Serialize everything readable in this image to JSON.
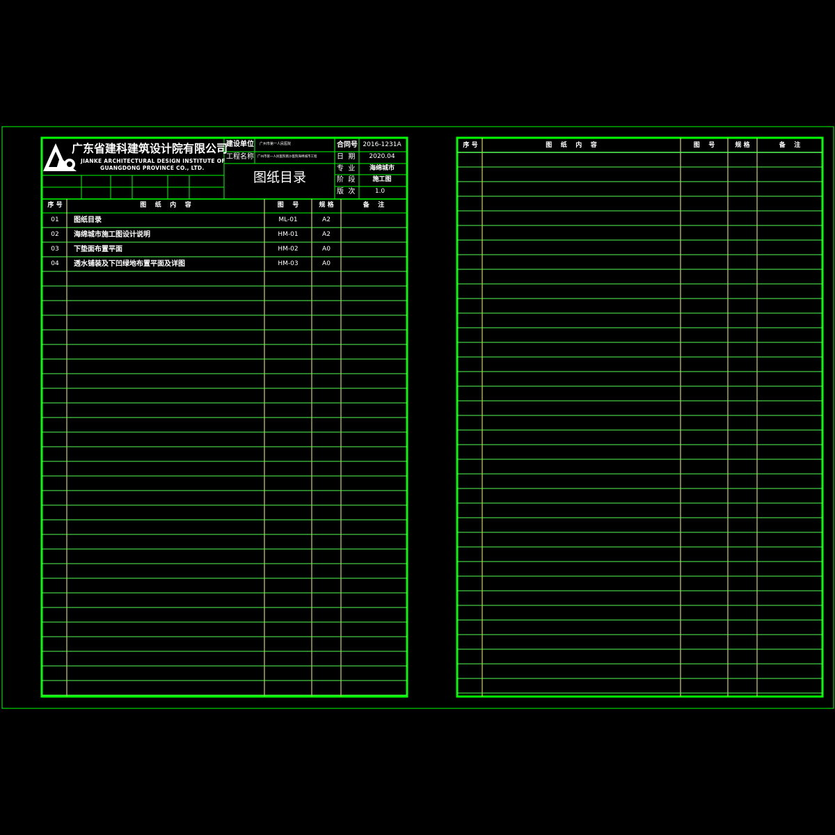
{
  "company": {
    "name_cn": "广东省建科建筑设计院有限公司",
    "name_en_line1": "JIANKE ARCHITECTURAL DESIGN INSTITUTE OF",
    "name_en_line2": "GUANGDONG PROVINCE CO., LTD."
  },
  "title_block": {
    "client_label": "建设单位",
    "client_value": "广州市第一人民医院",
    "project_label": "工程名称",
    "project_value": "广州市第一人民医院南沙医院海绵城市工程",
    "drawing_title": "图纸目录",
    "contract_label": "合同号",
    "contract_value": "2016-1231A",
    "date_label": "日  期",
    "date_value": "2020.04",
    "discipline_label": "专  业",
    "discipline_value": "海绵城市",
    "stage_label": "阶  段",
    "stage_value": "施工图",
    "version_label": "版  次",
    "version_value": "1.0"
  },
  "table": {
    "headers": {
      "seq": "序 号",
      "content": "图    纸    内    容",
      "drawing_no": "图    号",
      "size": "规 格",
      "remark": "备    注"
    },
    "rows": [
      {
        "seq": "01",
        "content": "图纸目录",
        "drawing_no": "ML-01",
        "size": "A2"
      },
      {
        "seq": "02",
        "content": "海绵城市施工图设计说明",
        "drawing_no": "HM-01",
        "size": "A2"
      },
      {
        "seq": "03",
        "content": "下垫面布置平面",
        "drawing_no": "HM-02",
        "size": "A0"
      },
      {
        "seq": "04",
        "content": "透水铺装及下凹绿地布置平面及详图",
        "drawing_no": "HM-03",
        "size": "A0"
      }
    ]
  },
  "colors": {
    "background": "#000000",
    "bright_green": "#00ff00",
    "line_green": "#55ff55",
    "col_yellow": "#ffff55",
    "text": "#ffffff"
  }
}
